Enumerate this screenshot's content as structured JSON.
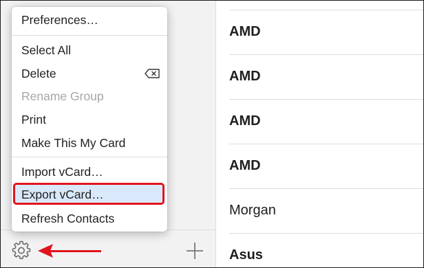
{
  "menu": {
    "items": [
      {
        "label": "Preferences…",
        "enabled": true
      },
      {
        "label": "Select All",
        "enabled": true
      },
      {
        "label": "Delete",
        "enabled": true,
        "shortcut_icon": "delete-key-icon"
      },
      {
        "label": "Rename Group",
        "enabled": false
      },
      {
        "label": "Print",
        "enabled": true
      },
      {
        "label": "Make This My Card",
        "enabled": true
      },
      {
        "label": "Import vCard…",
        "enabled": true
      },
      {
        "label": "Export vCard…",
        "enabled": true,
        "highlighted": true
      },
      {
        "label": "Refresh Contacts",
        "enabled": true
      }
    ]
  },
  "sidebar": {
    "footer": {
      "gear_icon": "gear-icon",
      "add_icon": "plus-icon"
    }
  },
  "annotation": {
    "highlight_color": "#e0141c",
    "arrow_color": "#e0141c"
  },
  "contacts": {
    "rows": [
      {
        "name": "AMD",
        "bold": true
      },
      {
        "name": "AMD",
        "bold": true
      },
      {
        "name": "AMD",
        "bold": true
      },
      {
        "name": "AMD",
        "bold": true
      },
      {
        "name": "Morgan",
        "bold": false
      },
      {
        "name": "Asus",
        "bold": true
      }
    ]
  }
}
